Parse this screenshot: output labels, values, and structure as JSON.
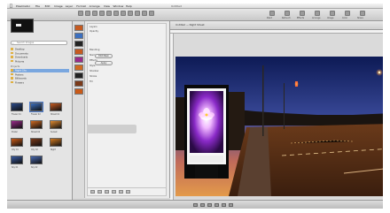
{
  "menubar": {
    "apple": "",
    "menus": [
      "Pixelmator",
      "File",
      "Edit",
      "Image",
      "Layer",
      "Format",
      "Arrange",
      "View",
      "Window",
      "Help"
    ],
    "window_title": "Untitled",
    "status": ""
  },
  "toolbar": {
    "tools": [
      "Move",
      "Select",
      "Crop",
      "Brush",
      "Type",
      "Shape",
      "Fill",
      "Eraser",
      "Color",
      "Effects",
      "Zoom"
    ],
    "right_tools": [
      "Paint",
      "Retouch",
      "Effects",
      "Arrange",
      "Image",
      "Color",
      "Share"
    ]
  },
  "library": {
    "search_placeholder": "Search Images",
    "sources": [
      {
        "label": "Desktop",
        "icon": "folder-icon",
        "selected": false
      },
      {
        "label": "Documents",
        "icon": "folder-icon",
        "selected": false
      },
      {
        "label": "Downloads",
        "icon": "folder-icon",
        "selected": false
      },
      {
        "label": "Pictures",
        "icon": "folder-icon",
        "selected": false
      }
    ],
    "section_head": "Projects",
    "projects": [
      {
        "label": "Night City",
        "icon": "folder-icon",
        "selected": true
      },
      {
        "label": "Posters",
        "icon": "folder-icon",
        "selected": false
      },
      {
        "label": "Billboards",
        "icon": "folder-icon",
        "selected": false
      },
      {
        "label": "Flowers",
        "icon": "folder-icon",
        "selected": false
      }
    ],
    "thumbnails": [
      {
        "caption": "Flower 01",
        "color": "#2a4a8a",
        "selected": false
      },
      {
        "caption": "Flower 02",
        "color": "#3b6fbf",
        "selected": true
      },
      {
        "caption": "Street 01",
        "color": "#c65a20",
        "selected": false
      },
      {
        "caption": "Poster",
        "color": "#9a2a8a",
        "selected": false
      },
      {
        "caption": "Street 02",
        "color": "#d06a20",
        "selected": false
      },
      {
        "caption": "Sunset",
        "color": "#e08a30",
        "selected": false
      },
      {
        "caption": "City 01",
        "color": "#c95a18",
        "selected": false
      },
      {
        "caption": "City 02",
        "color": "#7a3a1a",
        "selected": false
      },
      {
        "caption": "Night",
        "color": "#d07820",
        "selected": false
      },
      {
        "caption": "Sky 01",
        "color": "#3a5aa0",
        "selected": false
      },
      {
        "caption": "Sky 02",
        "color": "#4a6ab0",
        "selected": false
      }
    ]
  },
  "layers": {
    "layer_thumbs": [
      "#c65a20",
      "#3b6fbf",
      "#222222",
      "#c65a20",
      "#9a2a8a",
      "#d06a20",
      "#222222",
      "#7a3a1a",
      "#c95a18"
    ],
    "inspector_rows": [
      "Layers",
      "Opacity",
      "Blending",
      "Normal",
      "Effects",
      "Style",
      "Shadow",
      "Stroke",
      "Fill"
    ],
    "buttons": [
      "Edit Mask",
      "Apply"
    ],
    "footer_buttons": [
      "+",
      "-",
      "fx",
      "mask",
      "group",
      "lock"
    ]
  },
  "canvas": {
    "tab_title": "Untitled — Night Street"
  },
  "statusbar": {
    "left": "",
    "right": ""
  },
  "colors": {
    "accent": "#4a78c8",
    "selection": "#7aa7df"
  }
}
